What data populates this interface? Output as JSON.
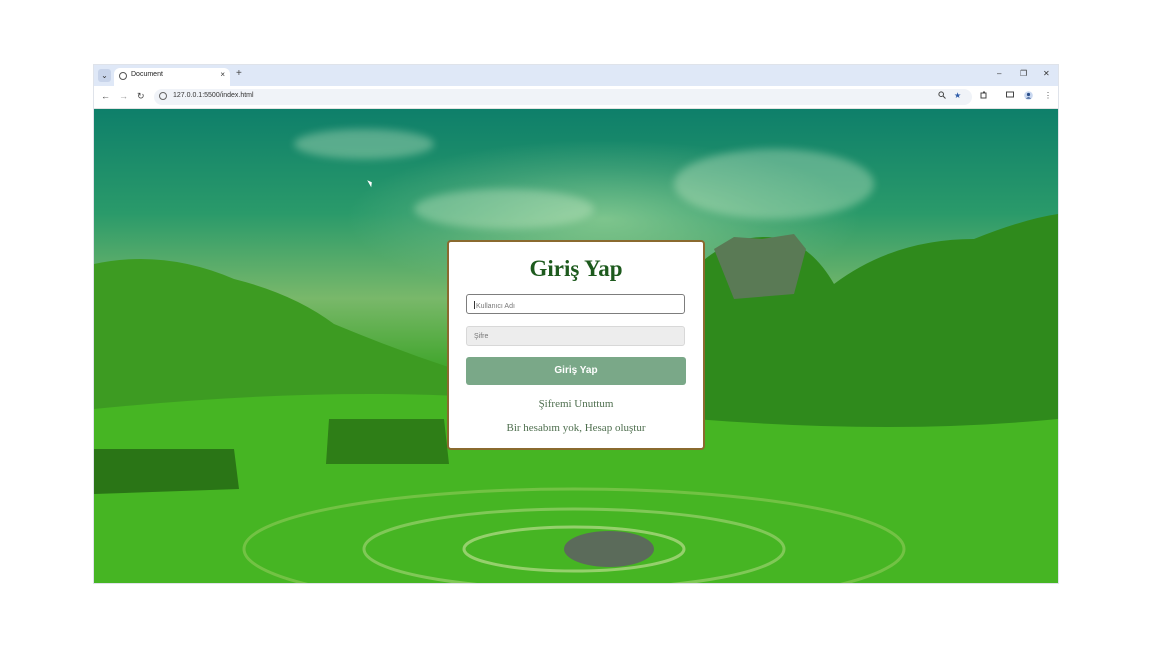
{
  "browser": {
    "tab_title": "Document",
    "tab_close": "×",
    "new_tab": "+",
    "tab_list": "⌄",
    "url": "127.0.0.1:5500/index.html",
    "window_controls": {
      "minimize": "–",
      "restore": "❐",
      "close": "✕"
    },
    "nav": {
      "back": "←",
      "forward": "→",
      "reload": "↻"
    },
    "icons": {
      "zoom": "zoom-icon",
      "bookmark": "star-icon",
      "extensions": "puzzle-icon",
      "profile": "profile-icon"
    }
  },
  "login": {
    "title": "Giriş Yap",
    "username_placeholder": "Kullanıcı Adı",
    "password_placeholder": "Şifre",
    "submit_label": "Giriş Yap",
    "forgot_link": "Şifremi Unuttum",
    "register_link": "Bir hesabım yok, Hesap oluştur"
  },
  "colors": {
    "title": "#1d5a1d",
    "button": "#7aa888",
    "card_border": "#8a6a2f",
    "link": "#4f6f4f"
  }
}
